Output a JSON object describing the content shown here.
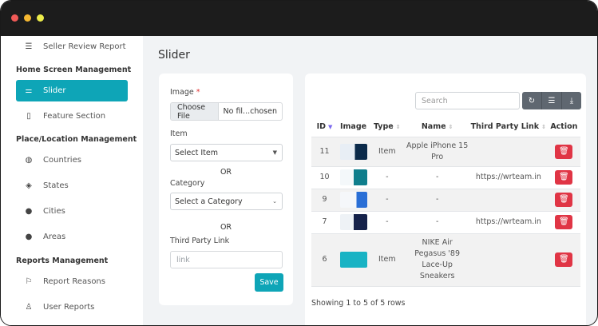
{
  "sidebar": {
    "top_item": "Seller Review Report",
    "sections": [
      {
        "title": "Home Screen Management"
      },
      {
        "title": "Place/Location Management"
      },
      {
        "title": "Reports Management"
      }
    ],
    "items": {
      "slider": "Slider",
      "feature_section": "Feature Section",
      "countries": "Countries",
      "states": "States",
      "cities": "Cities",
      "areas": "Areas",
      "report_reasons": "Report Reasons",
      "user_reports": "User Reports"
    }
  },
  "page": {
    "title": "Slider"
  },
  "form": {
    "image_label": "Image",
    "required_mark": "*",
    "choose_file": "Choose File",
    "file_text": "No fil...chosen",
    "item_label": "Item",
    "item_select": "Select Item",
    "or1": "OR",
    "category_label": "Category",
    "category_select": "Select a Category",
    "or2": "OR",
    "third_party_label": "Third Party Link",
    "link_placeholder": "link",
    "save": "Save"
  },
  "table": {
    "search_placeholder": "Search",
    "toolbar": [
      "refresh-icon",
      "list-icon",
      "download-icon"
    ],
    "headers": {
      "id": "ID",
      "image": "Image",
      "type": "Type",
      "name": "Name",
      "link": "Third Party Link",
      "action": "Action"
    },
    "rows": [
      {
        "id": "11",
        "type": "Item",
        "name": "Apple iPhone 15 Pro",
        "link": ""
      },
      {
        "id": "10",
        "type": "-",
        "name": "-",
        "link": "https://wrteam.in"
      },
      {
        "id": "9",
        "type": "-",
        "name": "-",
        "link": ""
      },
      {
        "id": "7",
        "type": "-",
        "name": "-",
        "link": "https://wrteam.in"
      },
      {
        "id": "6",
        "type": "Item",
        "name": "NIKE Air Pegasus '89 Lace-Up Sneakers",
        "link": ""
      }
    ],
    "footer": "Showing 1 to 5 of 5 rows"
  },
  "colors": {
    "accent": "#0ea5b7",
    "danger": "#e03545",
    "titlebar": "#1c1c1c"
  }
}
